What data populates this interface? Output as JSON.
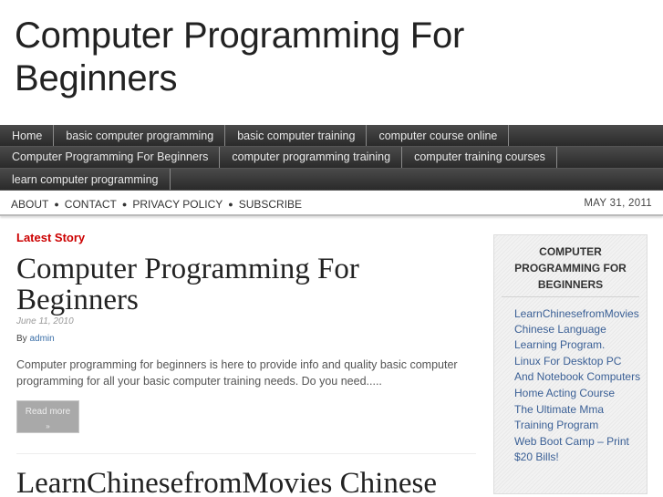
{
  "site": {
    "title": "Computer Programming For Beginners"
  },
  "nav": {
    "rows": [
      [
        "Home",
        "basic computer programming",
        "basic computer training",
        "computer course online"
      ],
      [
        "Computer Programming For Beginners",
        "computer programming training",
        "computer training courses"
      ],
      [
        "learn computer programming"
      ]
    ]
  },
  "subnav": {
    "links": [
      "ABOUT",
      "CONTACT",
      "PRIVACY POLICY",
      "SUBSCRIBE"
    ],
    "separator": "●",
    "date": "MAY 31, 2011"
  },
  "main": {
    "section_label": "Latest Story",
    "posts": [
      {
        "title": "Computer Programming For Beginners",
        "date": "June 11, 2010",
        "by_label": "By",
        "author": "admin",
        "excerpt": "Computer programming for beginners is here to provide info and quality basic computer programming for all your basic computer training needs. Do you need.....",
        "read_more": "Read more",
        "read_more_arrow": "»"
      },
      {
        "title": "LearnChinesefromMovies Chinese"
      }
    ]
  },
  "sidebar": {
    "widget_title": "COMPUTER PROGRAMMING FOR BEGINNERS",
    "links": [
      "LearnChinesefromMovies Chinese Language Learning Program.",
      "Linux For Desktop PC And Notebook Computers",
      "Home Acting Course",
      "The Ultimate Mma Training Program",
      "Web Boot Camp – Print $20 Bills!"
    ]
  }
}
